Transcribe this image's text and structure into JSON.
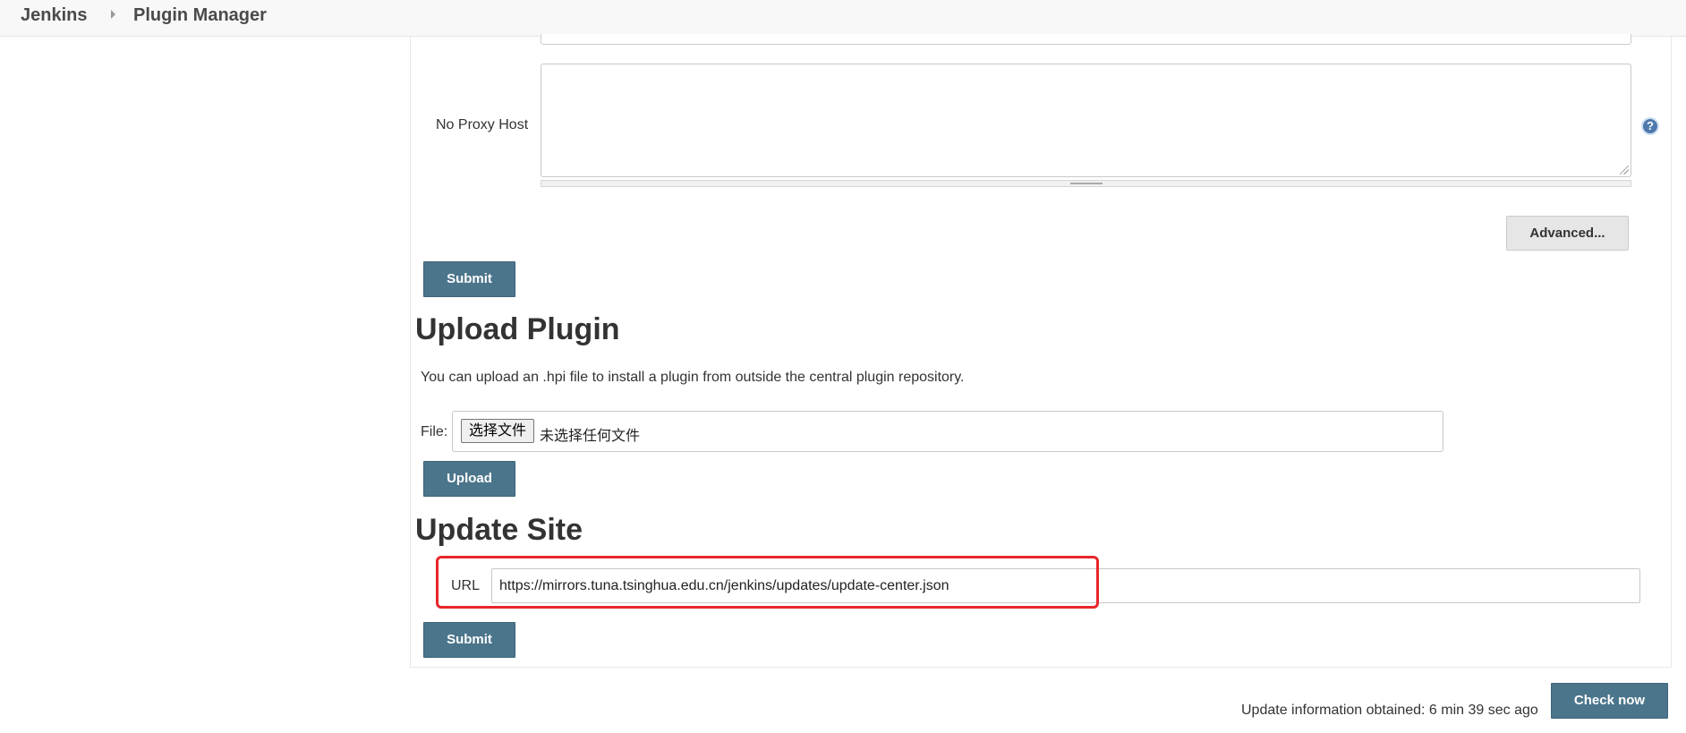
{
  "breadcrumb": {
    "home": "Jenkins",
    "current": "Plugin Manager"
  },
  "proxy": {
    "no_proxy_host_label": "No Proxy Host",
    "no_proxy_host_value": "",
    "help_icon": "question-mark-icon",
    "advanced_label": "Advanced...",
    "submit_label": "Submit"
  },
  "upload_plugin": {
    "heading": "Upload Plugin",
    "description": "You can upload an .hpi file to install a plugin from outside the central plugin repository.",
    "file_label": "File:",
    "choose_file_label": "选择文件",
    "no_file_chosen": "未选择任何文件",
    "upload_label": "Upload"
  },
  "update_site": {
    "heading": "Update Site",
    "url_label": "URL",
    "url_value": "https://mirrors.tuna.tsinghua.edu.cn/jenkins/updates/update-center.json",
    "submit_label": "Submit"
  },
  "footer": {
    "update_info": "Update information obtained: 6 min 39 sec ago",
    "check_now_label": "Check now"
  },
  "colors": {
    "primary_button": "#4b758b",
    "highlight_border": "#e8262a",
    "help_icon": "#4e79ad"
  }
}
